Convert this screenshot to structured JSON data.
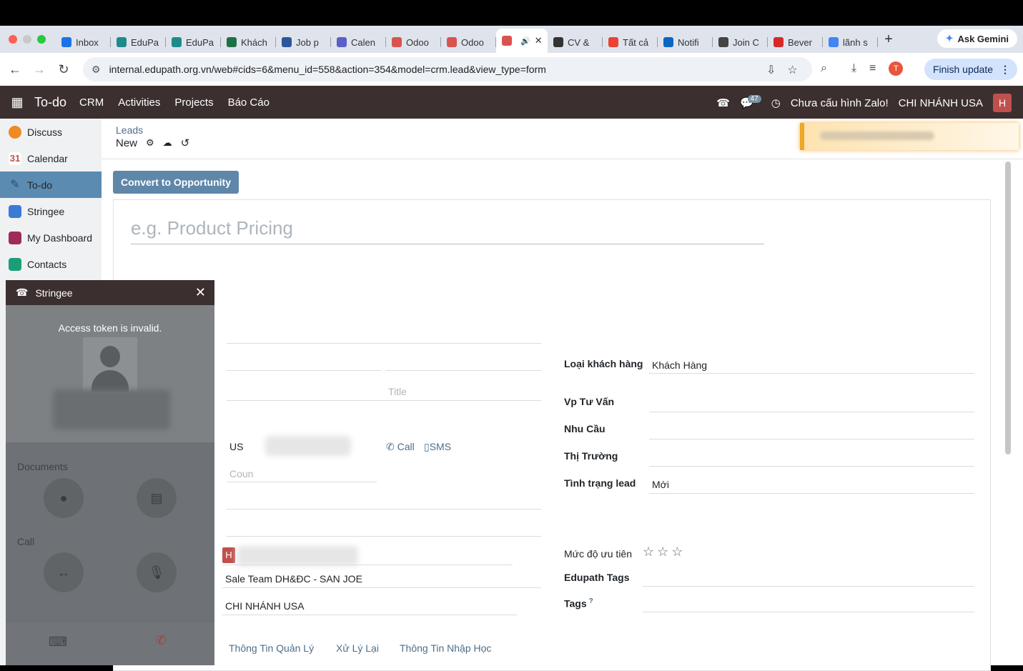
{
  "browser": {
    "tabs": [
      {
        "label": "Inbox",
        "icon": "outlook-icon",
        "color": "#1a73e8"
      },
      {
        "label": "EduPa",
        "icon": "edupath-icon",
        "color": "#1f8a8a"
      },
      {
        "label": "EduPa",
        "icon": "edupath-icon",
        "color": "#1f8a8a"
      },
      {
        "label": "Khách",
        "icon": "excel-icon",
        "color": "#1e7145"
      },
      {
        "label": "Job p",
        "icon": "word-icon",
        "color": "#2b579a"
      },
      {
        "label": "Calen",
        "icon": "teams-icon",
        "color": "#5b5fc7"
      },
      {
        "label": "Odoo",
        "icon": "odoo-icon",
        "color": "#d9534f"
      },
      {
        "label": "Odoo",
        "icon": "odoo-icon",
        "color": "#d9534f"
      },
      {
        "label": "",
        "icon": "odoo-icon",
        "color": "#d9534f",
        "active": true
      },
      {
        "label": "CV &",
        "icon": "chatgpt-icon",
        "color": "#333333"
      },
      {
        "label": "Tất cả",
        "icon": "gmail-icon",
        "color": "#ea4335"
      },
      {
        "label": "Notifi",
        "icon": "linkedin-icon",
        "color": "#0a66c2"
      },
      {
        "label": "Join C",
        "icon": "join-icon",
        "color": "#444444"
      },
      {
        "label": "Bever",
        "icon": "bever-icon",
        "color": "#d62828"
      },
      {
        "label": "lãnh s",
        "icon": "google-icon",
        "color": "#4285f4"
      }
    ],
    "gemini_label": "Ask Gemini",
    "url": "internal.edupath.org.vn/web#cids=6&menu_id=558&action=354&model=crm.lead&view_type=form",
    "finish_update": "Finish update",
    "profile_initial": "T"
  },
  "navbar": {
    "brand": "To-do",
    "menu": [
      "CRM",
      "Activities",
      "Projects",
      "Báo Cáo"
    ],
    "chat_badge": "47",
    "zalo": "Chưa cấu hình Zalo!",
    "company": "CHI NHÁNH USA",
    "user_initial": "H"
  },
  "sidebar": {
    "items": [
      {
        "label": "Discuss",
        "color": "#f08a24"
      },
      {
        "label": "Calendar",
        "color": "#c0504d"
      },
      {
        "label": "To-do",
        "color": "#2a6f97",
        "active": true
      },
      {
        "label": "Stringee",
        "color": "#3a7bd5"
      },
      {
        "label": "My Dashboard",
        "color": "#a02b5a"
      },
      {
        "label": "Contacts",
        "color": "#1b9e77"
      }
    ]
  },
  "form": {
    "breadcrumb": "Leads",
    "record": "New",
    "convert_button": "Convert to Opportunity",
    "title_placeholder": "e.g. Product Pricing",
    "title_field_placeholder": "Title",
    "phone_country": "US",
    "call_label": "Call",
    "sms_label": "SMS",
    "country_placeholder": "Coun",
    "salesperson_initial": "H",
    "sales_team": "Sale Team DH&ĐC - SAN JOE",
    "company": "CHI NHÁNH USA",
    "right": {
      "customer_type_label": "Loại khách hàng",
      "customer_type_value": "Khách Hàng",
      "office_label": "Vp Tư Vấn",
      "need_label": "Nhu Cầu",
      "market_label": "Thị Trường",
      "status_label": "Tình trạng lead",
      "status_value": "Mới",
      "priority_label": "Mức độ ưu tiên",
      "priority_stars": "☆☆☆",
      "edupath_tags_label": "Edupath Tags",
      "tags_label": "Tags",
      "tags_help": "?"
    },
    "tabs": [
      "Thông Tin Quản Lý",
      "Xử Lý Lại",
      "Thông Tin Nhập Học"
    ]
  },
  "stringee": {
    "title": "Stringee",
    "message": "Access token is invalid.",
    "documents_label": "Documents",
    "call_label": "Call"
  }
}
